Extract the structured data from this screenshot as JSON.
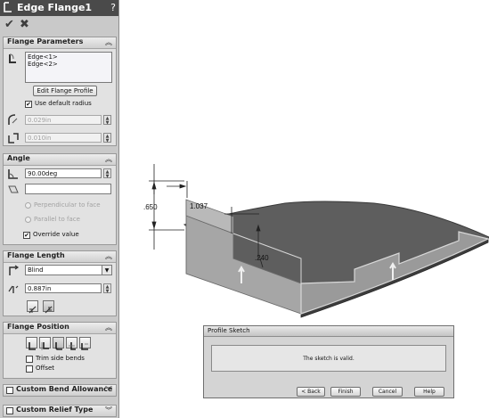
{
  "property_manager": {
    "title": "Edge Flange1",
    "help": "?",
    "ok_icon": "checkmark-icon",
    "cancel_icon": "x-icon",
    "flange_parameters": {
      "header": "Flange Parameters",
      "edges": [
        "Edge<1>",
        "Edge<2>"
      ],
      "edit_button": "Edit Flange Profile",
      "use_default_radius_label": "Use default radius",
      "use_default_radius_checked": true,
      "bend_radius": "0.029in",
      "gap": "0.010in"
    },
    "angle": {
      "header": "Angle",
      "value": "90.00deg",
      "reference": "",
      "perpendicular_label": "Perpendicular to face",
      "parallel_label": "Parallel to face",
      "override_label": "Override value",
      "override_checked": true
    },
    "flange_length": {
      "header": "Flange Length",
      "end_condition": "Blind",
      "length": "0.887in"
    },
    "flange_position": {
      "header": "Flange Position",
      "trim_side_bends_label": "Trim side bends",
      "offset_label": "Offset"
    },
    "custom_bend_allowance": "Custom Bend Allowance",
    "custom_relief_type": "Custom Relief Type"
  },
  "dimensions": {
    "d1": ".650",
    "d2": "1.037",
    "d3": ".240"
  },
  "dialog": {
    "title": "Profile Sketch",
    "message": "The sketch is valid.",
    "buttons": {
      "back": "< Back",
      "finish": "Finish",
      "cancel": "Cancel",
      "help": "Help"
    }
  },
  "colors": {
    "title_bar": "#4a4a4a",
    "panel": "#c9c9c9",
    "part_face": "#5a5a5a",
    "flange_face": "#a3a3a3"
  }
}
